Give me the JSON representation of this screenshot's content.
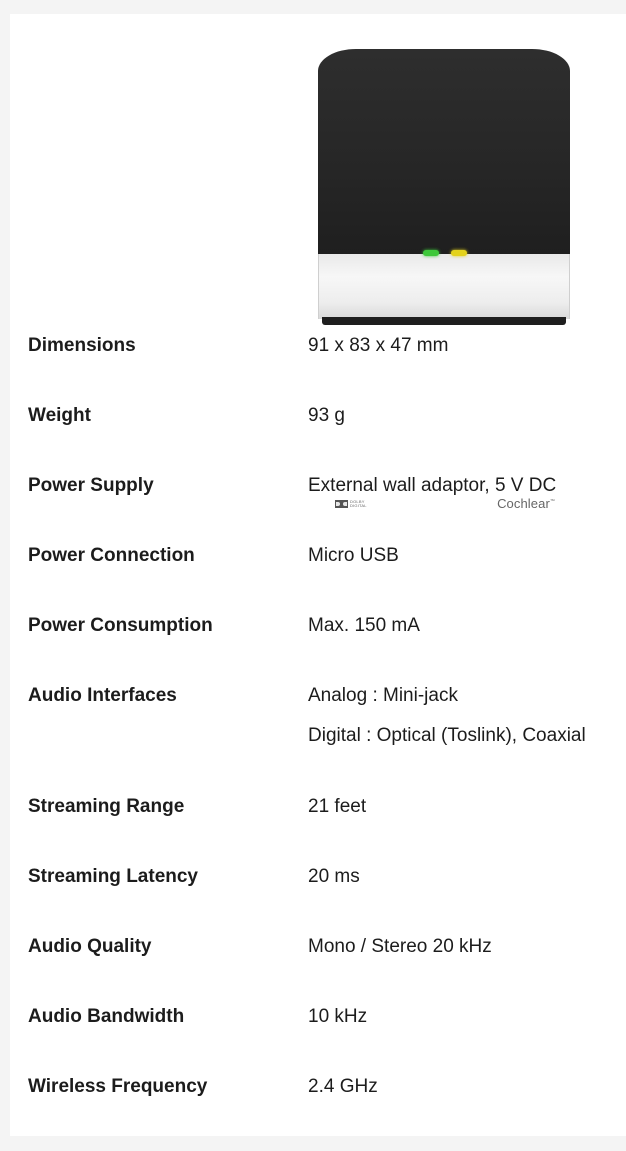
{
  "product": {
    "brand": "Cochlear",
    "brand_mark": "™",
    "dolby_text_line1": "DOLBY",
    "dolby_text_line2": "DIGITAL",
    "led_colors": {
      "left": "#3ec83a",
      "right": "#e3d21c"
    }
  },
  "specs": [
    {
      "label": "Dimensions",
      "values": [
        "91 x 83 x 47 mm"
      ]
    },
    {
      "label": "Weight",
      "values": [
        "93 g"
      ]
    },
    {
      "label": "Power Supply",
      "values": [
        "External wall adaptor, 5 V DC"
      ]
    },
    {
      "label": "Power Connection",
      "values": [
        "Micro USB"
      ]
    },
    {
      "label": "Power Consumption",
      "values": [
        "Max. 150 mA"
      ]
    },
    {
      "label": "Audio Interfaces",
      "values": [
        "Analog : Mini-jack",
        "Digital : Optical (Toslink), Coaxial"
      ]
    },
    {
      "label": "Streaming Range",
      "values": [
        "21 feet"
      ]
    },
    {
      "label": "Streaming Latency",
      "values": [
        "20 ms"
      ]
    },
    {
      "label": "Audio Quality",
      "values": [
        "Mono / Stereo 20 kHz"
      ]
    },
    {
      "label": "Audio Bandwidth",
      "values": [
        "10 kHz"
      ]
    },
    {
      "label": "Wireless Frequency",
      "values": [
        "2.4 GHz"
      ]
    }
  ]
}
